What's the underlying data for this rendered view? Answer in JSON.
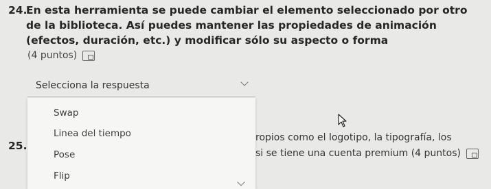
{
  "q24": {
    "number": "24.",
    "text": "En esta herramienta se puede cambiar el elemento seleccionado por otro de la biblioteca. Así puedes mantener las propiedades de animación (efectos, duración, etc.) y modificar sólo su aspecto o forma",
    "points": "(4 puntos)"
  },
  "select": {
    "label": "Selecciona la respuesta",
    "options": [
      "Swap",
      "Linea del tiempo",
      "Pose",
      "Flip"
    ]
  },
  "q25": {
    "number": "25.",
    "line1": "ropios como el logotipo, la tipografía, los",
    "line2": "si se tiene una cuenta premium (4 puntos)"
  },
  "icons": {
    "immersive_reader": "immersive-reader-icon",
    "dropdown_chevron": "chevron-down-icon",
    "cursor": "mouse-pointer-icon"
  }
}
